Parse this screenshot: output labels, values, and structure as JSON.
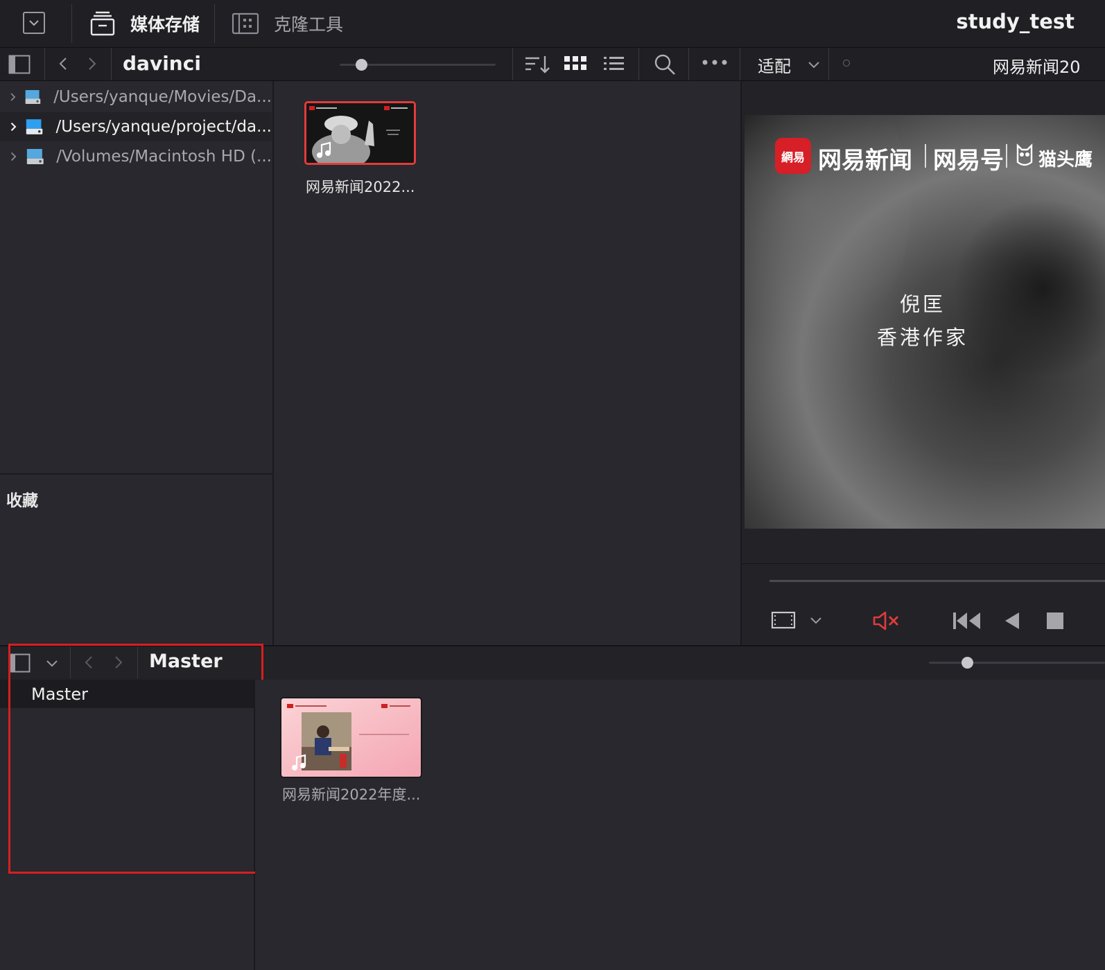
{
  "header": {
    "media_storage_label": "媒体存储",
    "clone_tool_label": "克隆工具",
    "project_name": "study_test"
  },
  "browser": {
    "current_folder": "davinci",
    "fit_label": "适配",
    "viewer_clip_title": "网易新闻20"
  },
  "locations": [
    {
      "path": "/Users/yanque/Movies/Da...",
      "selected": false
    },
    {
      "path": "/Users/yanque/project/da...",
      "selected": true
    },
    {
      "path": "/Volumes/Macintosh HD (...",
      "selected": false
    }
  ],
  "favorites_label": "收藏",
  "media_clips": [
    {
      "name": "网易新闻2022...",
      "selected": true,
      "has_audio": true
    }
  ],
  "viewer_overlay": {
    "logo_news": "网易新闻",
    "logo_hao": "网易号",
    "logo_owl": "猫头鹰",
    "logo_badge": "網易",
    "subtitle_line1": "倪匡",
    "subtitle_line2": "香港作家"
  },
  "media_pool": {
    "current_bin": "Master",
    "bins": [
      "Master"
    ],
    "clips": [
      {
        "name": "网易新闻2022年度...",
        "has_audio": true
      }
    ]
  },
  "colors": {
    "accent_red": "#e23b3b",
    "selection_red": "#d91e1e",
    "panel_bg": "#28282e",
    "toolbar_bg": "#1f1f24"
  }
}
